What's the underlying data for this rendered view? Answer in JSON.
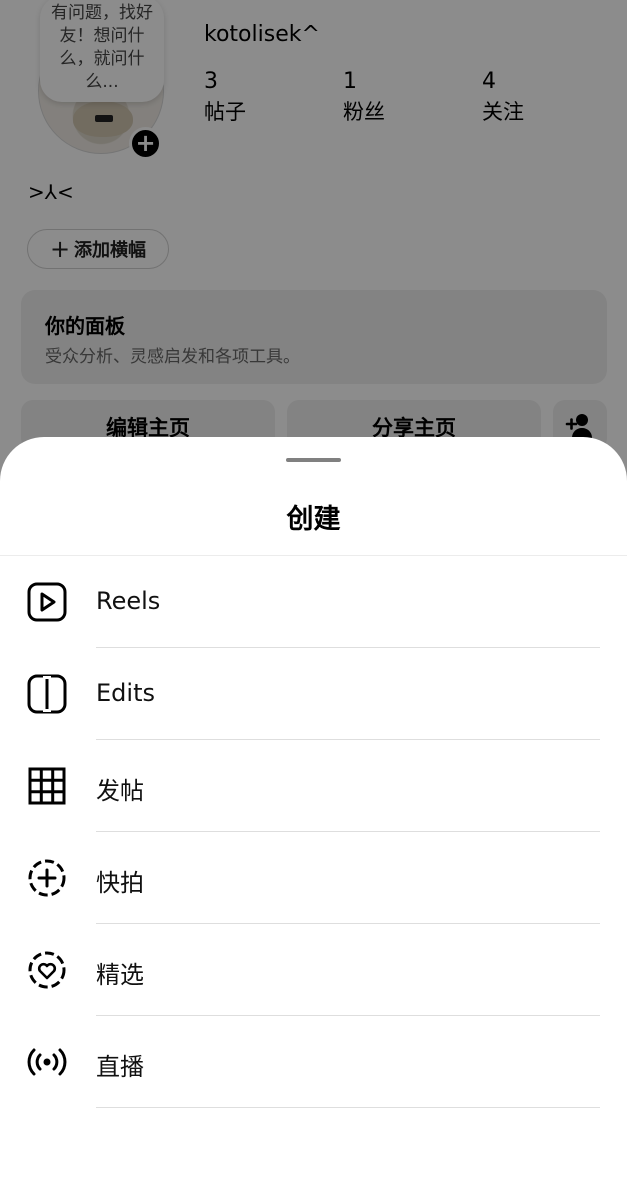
{
  "profile": {
    "note_text": "有问题，找好友！想问什么，就问什么...",
    "username": "kotolisek^",
    "stats": [
      {
        "value": "3",
        "label": "帖子"
      },
      {
        "value": "1",
        "label": "粉丝"
      },
      {
        "value": "4",
        "label": "关注"
      }
    ],
    "bio": ">⅄<",
    "add_banner_label": "添加横幅",
    "panel_title": "你的面板",
    "panel_subtitle": "受众分析、灵感启发和各项工具。",
    "edit_profile_label": "编辑主页",
    "share_profile_label": "分享主页"
  },
  "sheet": {
    "title": "创建",
    "items": [
      {
        "label": "Reels",
        "icon": "reels-icon"
      },
      {
        "label": "Edits",
        "icon": "edits-icon"
      },
      {
        "label": "发帖",
        "icon": "grid-post-icon"
      },
      {
        "label": "快拍",
        "icon": "story-add-icon"
      },
      {
        "label": "精选",
        "icon": "highlight-heart-icon"
      },
      {
        "label": "直播",
        "icon": "live-icon"
      }
    ]
  }
}
